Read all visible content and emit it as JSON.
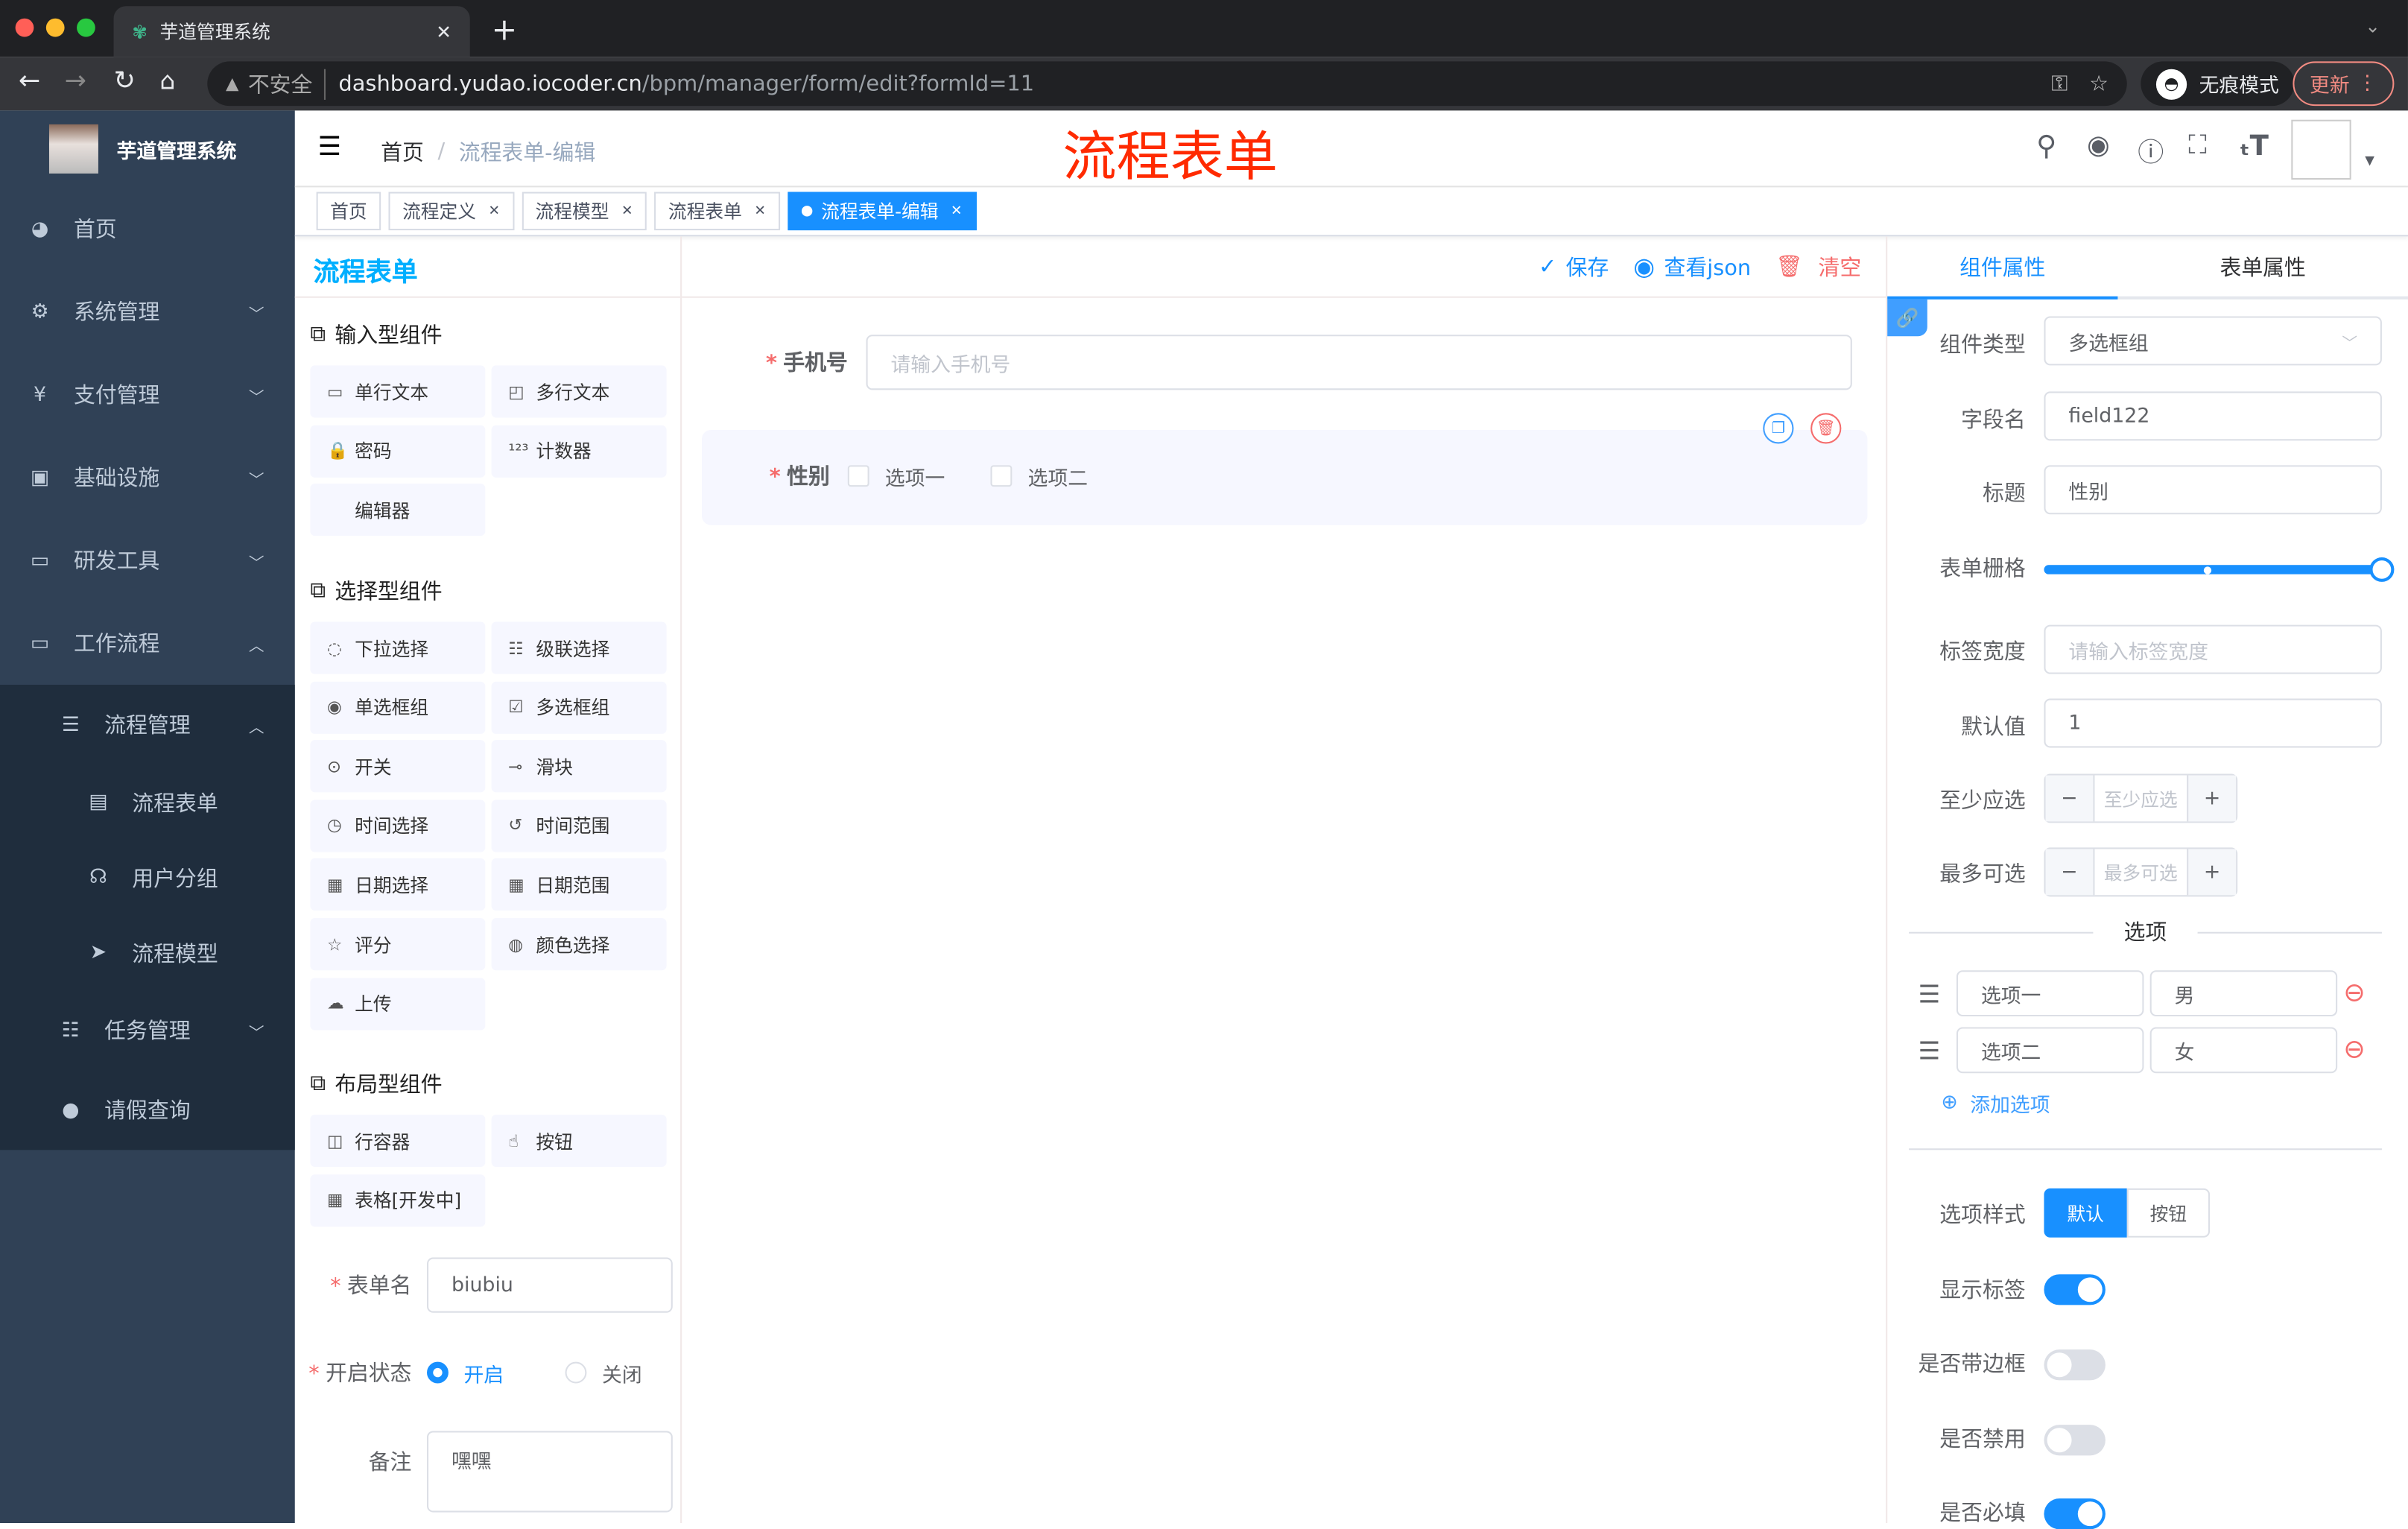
{
  "browser": {
    "tab_title": "芋道管理系统",
    "insecure_label": "不安全",
    "url_host": "dashboard.yudao.iocoder.cn",
    "url_path": "/bpm/manager/form/edit?formId=11",
    "incognito_label": "无痕模式",
    "update_label": "更新"
  },
  "sidebar": {
    "logo_title": "芋道管理系统",
    "items": [
      {
        "label": "首页",
        "icon": "dashboard-icon"
      },
      {
        "label": "系统管理",
        "icon": "gear-icon"
      },
      {
        "label": "支付管理",
        "icon": "yen-icon"
      },
      {
        "label": "基础设施",
        "icon": "monitor-icon"
      },
      {
        "label": "研发工具",
        "icon": "toolbox-icon"
      },
      {
        "label": "工作流程",
        "icon": "toolbox-icon"
      },
      {
        "label": "流程管理",
        "icon": "tree-icon"
      },
      {
        "label": "流程表单",
        "icon": "form-icon"
      },
      {
        "label": "用户分组",
        "icon": "group-icon"
      },
      {
        "label": "流程模型",
        "icon": "send-icon"
      },
      {
        "label": "任务管理",
        "icon": "tree-icon"
      },
      {
        "label": "请假查询",
        "icon": "user-icon"
      }
    ]
  },
  "header": {
    "breadcrumb": [
      "首页",
      "流程表单-编辑"
    ],
    "banner": "流程表单"
  },
  "tags": [
    "首页",
    "流程定义",
    "流程模型",
    "流程表单",
    "流程表单-编辑"
  ],
  "left": {
    "logo": "流程表单",
    "groups": [
      {
        "title": "输入型组件",
        "items": [
          "单行文本",
          "多行文本",
          "密码",
          "计数器",
          "编辑器"
        ]
      },
      {
        "title": "选择型组件",
        "items": [
          "下拉选择",
          "级联选择",
          "单选框组",
          "多选框组",
          "开关",
          "滑块",
          "时间选择",
          "时间范围",
          "日期选择",
          "日期范围",
          "评分",
          "颜色选择",
          "上传"
        ]
      },
      {
        "title": "布局型组件",
        "items": [
          "行容器",
          "按钮",
          "表格[开发中]"
        ]
      }
    ],
    "form_name_label": "表单名",
    "form_name": "biubiu",
    "status_label": "开启状态",
    "status_on": "开启",
    "status_off": "关闭",
    "status_value": "开启",
    "remark_label": "备注",
    "remark": "嘿嘿"
  },
  "toolbar": {
    "save": "保存",
    "view_json": "查看json",
    "clear": "清空"
  },
  "canvas": {
    "phone_label": "手机号",
    "phone_placeholder": "请输入手机号",
    "gender_label": "性别",
    "options": [
      "选项一",
      "选项二"
    ]
  },
  "right": {
    "tabs": [
      "组件属性",
      "表单属性"
    ],
    "active_tab": "组件属性",
    "type_label": "组件类型",
    "type_value": "多选框组",
    "field_label": "字段名",
    "field_value": "field122",
    "title_label": "标题",
    "title_value": "性别",
    "grid_label": "表单栅格",
    "grid_fraction": 1.0,
    "labelw_label": "标签宽度",
    "labelw_placeholder": "请输入标签宽度",
    "default_label": "默认值",
    "default_value": "1",
    "min_label": "至少应选",
    "min_placeholder": "至少应选",
    "max_label": "最多可选",
    "max_placeholder": "最多可选",
    "options_divider": "选项",
    "options": [
      {
        "label": "选项一",
        "value": "男"
      },
      {
        "label": "选项二",
        "value": "女"
      }
    ],
    "add_option": "添加选项",
    "style_label": "选项样式",
    "style_options": [
      "默认",
      "按钮"
    ],
    "style_value": "默认",
    "show_label_label": "显示标签",
    "show_label": true,
    "border_label": "是否带边框",
    "border": false,
    "disabled_label": "是否禁用",
    "disabled": false,
    "required_label": "是否必填",
    "required": true
  },
  "colors": {
    "primary": "#1890ff",
    "sidebar": "#304156",
    "danger": "#f56c6c",
    "banner": "#ff2a00"
  }
}
